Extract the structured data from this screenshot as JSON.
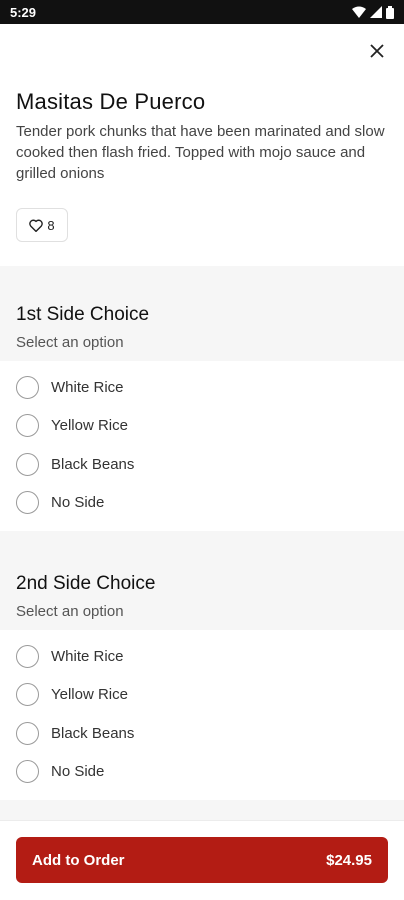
{
  "status_bar": {
    "time": "5:29"
  },
  "item": {
    "title": "Masitas De Puerco",
    "description": "Tender pork chunks that have been marinated and slow cooked then flash fried. Topped with mojo sauce and grilled onions",
    "likes": "8"
  },
  "sections": [
    {
      "title": "1st Side Choice",
      "subtitle": "Select an option",
      "options": [
        "White Rice",
        "Yellow Rice",
        "Black Beans",
        "No Side"
      ]
    },
    {
      "title": "2nd Side Choice",
      "subtitle": "Select an option",
      "options": [
        "White Rice",
        "Yellow Rice",
        "Black Beans",
        "No Side"
      ]
    }
  ],
  "footer": {
    "button_label": "Add to Order",
    "price": "$24.95"
  },
  "colors": {
    "accent": "#b31c14",
    "section_bg": "#f6f6f6"
  }
}
